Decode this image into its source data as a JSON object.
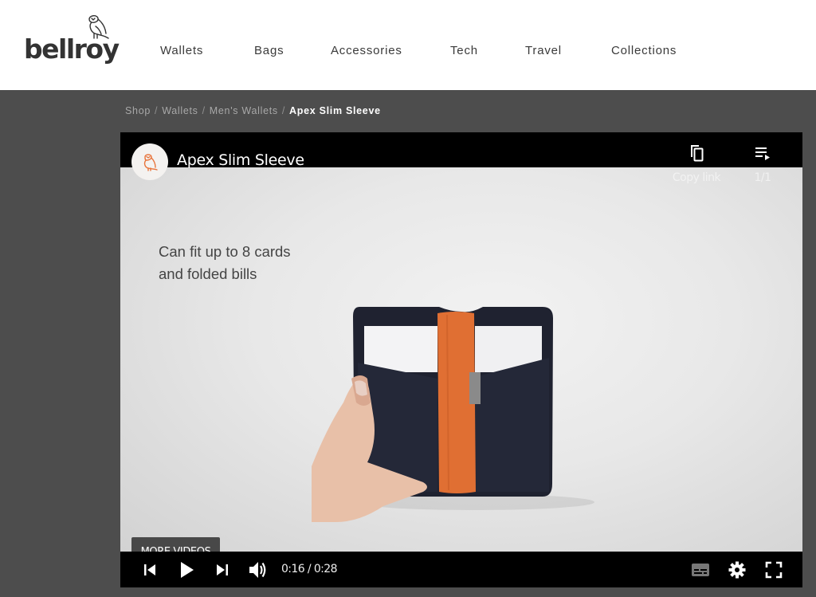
{
  "header": {
    "logo_text": "bellroy",
    "nav": [
      {
        "label": "Wallets"
      },
      {
        "label": "Bags"
      },
      {
        "label": "Accessories"
      },
      {
        "label": "Tech"
      },
      {
        "label": "Travel"
      },
      {
        "label": "Collections"
      }
    ]
  },
  "breadcrumb": {
    "items": [
      "Shop",
      "Wallets",
      "Men's Wallets"
    ],
    "current": "Apex Slim Sleeve",
    "separator": "/"
  },
  "player": {
    "title": "Apex Slim Sleeve",
    "copy_link_label": "Copy link",
    "playlist_label": "1/1",
    "overlay_text_line1": "Can fit up to 8 cards",
    "overlay_text_line2": "and folded bills",
    "more_videos_label": "MORE VIDEOS",
    "time_display": "0:16 / 0:28",
    "progress_fraction": 0.58,
    "colors": {
      "progress": "#ff0000",
      "brand_orange": "#e8733a"
    },
    "controls": {
      "left": [
        "previous-icon",
        "play-icon",
        "next-icon",
        "volume-icon"
      ],
      "right": [
        "subtitles-icon",
        "settings-icon",
        "fullscreen-icon"
      ]
    }
  }
}
